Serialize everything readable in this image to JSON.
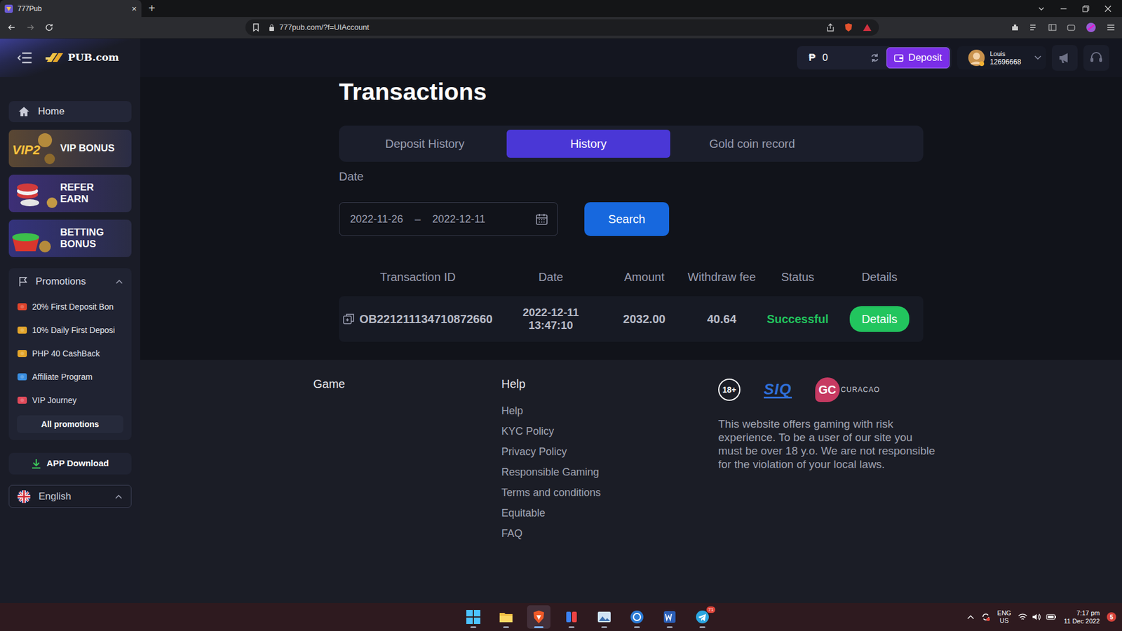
{
  "browser": {
    "tab_title": "777Pub",
    "tab_close": "×",
    "new_tab": "+",
    "url": "777pub.com/?f=UIAccount"
  },
  "header": {
    "currency": "₱",
    "balance": "0",
    "deposit": "Deposit",
    "user": {
      "name": "Louis",
      "id": "12696668"
    }
  },
  "sidebar": {
    "logo": "PUB.com",
    "home": "Home",
    "banners": [
      {
        "lines": [
          "VIP BONUS"
        ],
        "badge": "VIP2",
        "color": "#5a4733"
      },
      {
        "lines": [
          "REFER",
          "EARN"
        ],
        "color": "#3d2f77"
      },
      {
        "lines": [
          "BETTING",
          "BONUS"
        ],
        "color": "#34337c"
      }
    ],
    "promotions": {
      "title": "Promotions",
      "expanded": true,
      "items": [
        "20% First Deposit Bon",
        "10% Daily First Deposi",
        "PHP 40 CashBack",
        "Affiliate Program",
        "VIP Journey"
      ],
      "all": "All promotions"
    },
    "app_download": "APP Download",
    "language": "English"
  },
  "transactions": {
    "title": "Transactions",
    "tabs": [
      {
        "label": "Deposit History",
        "selected": false
      },
      {
        "label": "History",
        "selected": true
      },
      {
        "label": "Gold coin record",
        "selected": false
      }
    ],
    "date_label": "Date",
    "date_from": "2022-11-26",
    "date_sep": "–",
    "date_to": "2022-12-11",
    "search": "Search",
    "columns": [
      "Transaction ID",
      "Date",
      "Amount",
      "Withdraw fee",
      "Status",
      "Details"
    ],
    "rows": [
      {
        "id": "OB221211134710872660",
        "date": "2022-12-11",
        "time": "13:47:10",
        "amount": "2032.00",
        "fee": "40.64",
        "status": "Successful",
        "status_color": "#22c55e",
        "details": "Details"
      }
    ]
  },
  "footer": {
    "game": "Game",
    "help_title": "Help",
    "help_links": [
      "Help",
      "KYC Policy",
      "Privacy Policy",
      "Responsible Gaming",
      "Terms and conditions",
      "Equitable",
      "FAQ"
    ],
    "age": "18+",
    "siq": "SIQ",
    "gc": "GC",
    "gc_sub": "CURACAO",
    "disclaimer": "This website offers gaming with risk experience. To be a user of our site you must be over 18 y.o. We are not responsible for the violation of your local laws."
  },
  "taskbar": {
    "apps": [
      {
        "active": false,
        "badge": ""
      },
      {
        "active": false,
        "badge": ""
      },
      {
        "active": true,
        "badge": ""
      },
      {
        "active": false,
        "badge": ""
      },
      {
        "active": false,
        "badge": ""
      },
      {
        "active": false,
        "badge": ""
      },
      {
        "active": false,
        "badge": ""
      },
      {
        "active": false,
        "badge": "71"
      }
    ],
    "lang": "ENG",
    "region": "US",
    "time": "7:17 pm",
    "date": "11 Dec 2022",
    "notifications": "5"
  }
}
